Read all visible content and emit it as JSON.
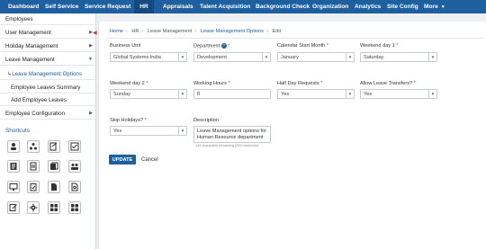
{
  "nav": {
    "items": [
      "Dashboard",
      "Self Service",
      "Service Request",
      "HR",
      "Appraisals",
      "Talent Acquisition",
      "Background Check",
      "Organization",
      "Analytics",
      "Site Config",
      "More"
    ]
  },
  "sidebar": {
    "items": [
      {
        "label": "Employees"
      },
      {
        "label": "User Management"
      },
      {
        "label": "Holiday Management"
      },
      {
        "label": "Leave Management"
      },
      {
        "label": "Leave Management Options"
      },
      {
        "label": "Employee Leaves Summary"
      },
      {
        "label": "Add Employee Leaves"
      },
      {
        "label": "Employee Configuration"
      }
    ],
    "shortcuts_title": "Shortcuts"
  },
  "breadcrumb": [
    "Home",
    "HR",
    "Leave Management",
    "Leave Management Options",
    "Edit"
  ],
  "form": {
    "business_unit": {
      "label": "Business Unit",
      "value": "Global Systems India"
    },
    "department": {
      "label": "Department",
      "value": "Development"
    },
    "calendar_start_month": {
      "label": "Calendar Start Month",
      "value": "January"
    },
    "weekend_day_1": {
      "label": "Weekend day 1",
      "value": "Saturday"
    },
    "weekend_day_2": {
      "label": "Weekend day 2",
      "value": "Sunday"
    },
    "working_hours": {
      "label": "Working Hours",
      "value": "8"
    },
    "half_day_requests": {
      "label": "Half Day Requests",
      "value": "Yes"
    },
    "allow_leave_transfers": {
      "label": "Allow Leave Transfers?",
      "value": "Yes"
    },
    "skip_holidays": {
      "label": "Skip Holidays?",
      "value": "Yes"
    },
    "description": {
      "label": "Description",
      "value": "Leave Management options for Human Resource department",
      "hint": "143 characters remaining (200 maximum)"
    }
  },
  "buttons": {
    "update": "UPDATE",
    "cancel": "Cancel"
  },
  "colors": {
    "nav_bg": "#1e5fa0",
    "nav_active": "#154a80",
    "primary_button": "#1e5fa0",
    "required": "#c0392b"
  }
}
